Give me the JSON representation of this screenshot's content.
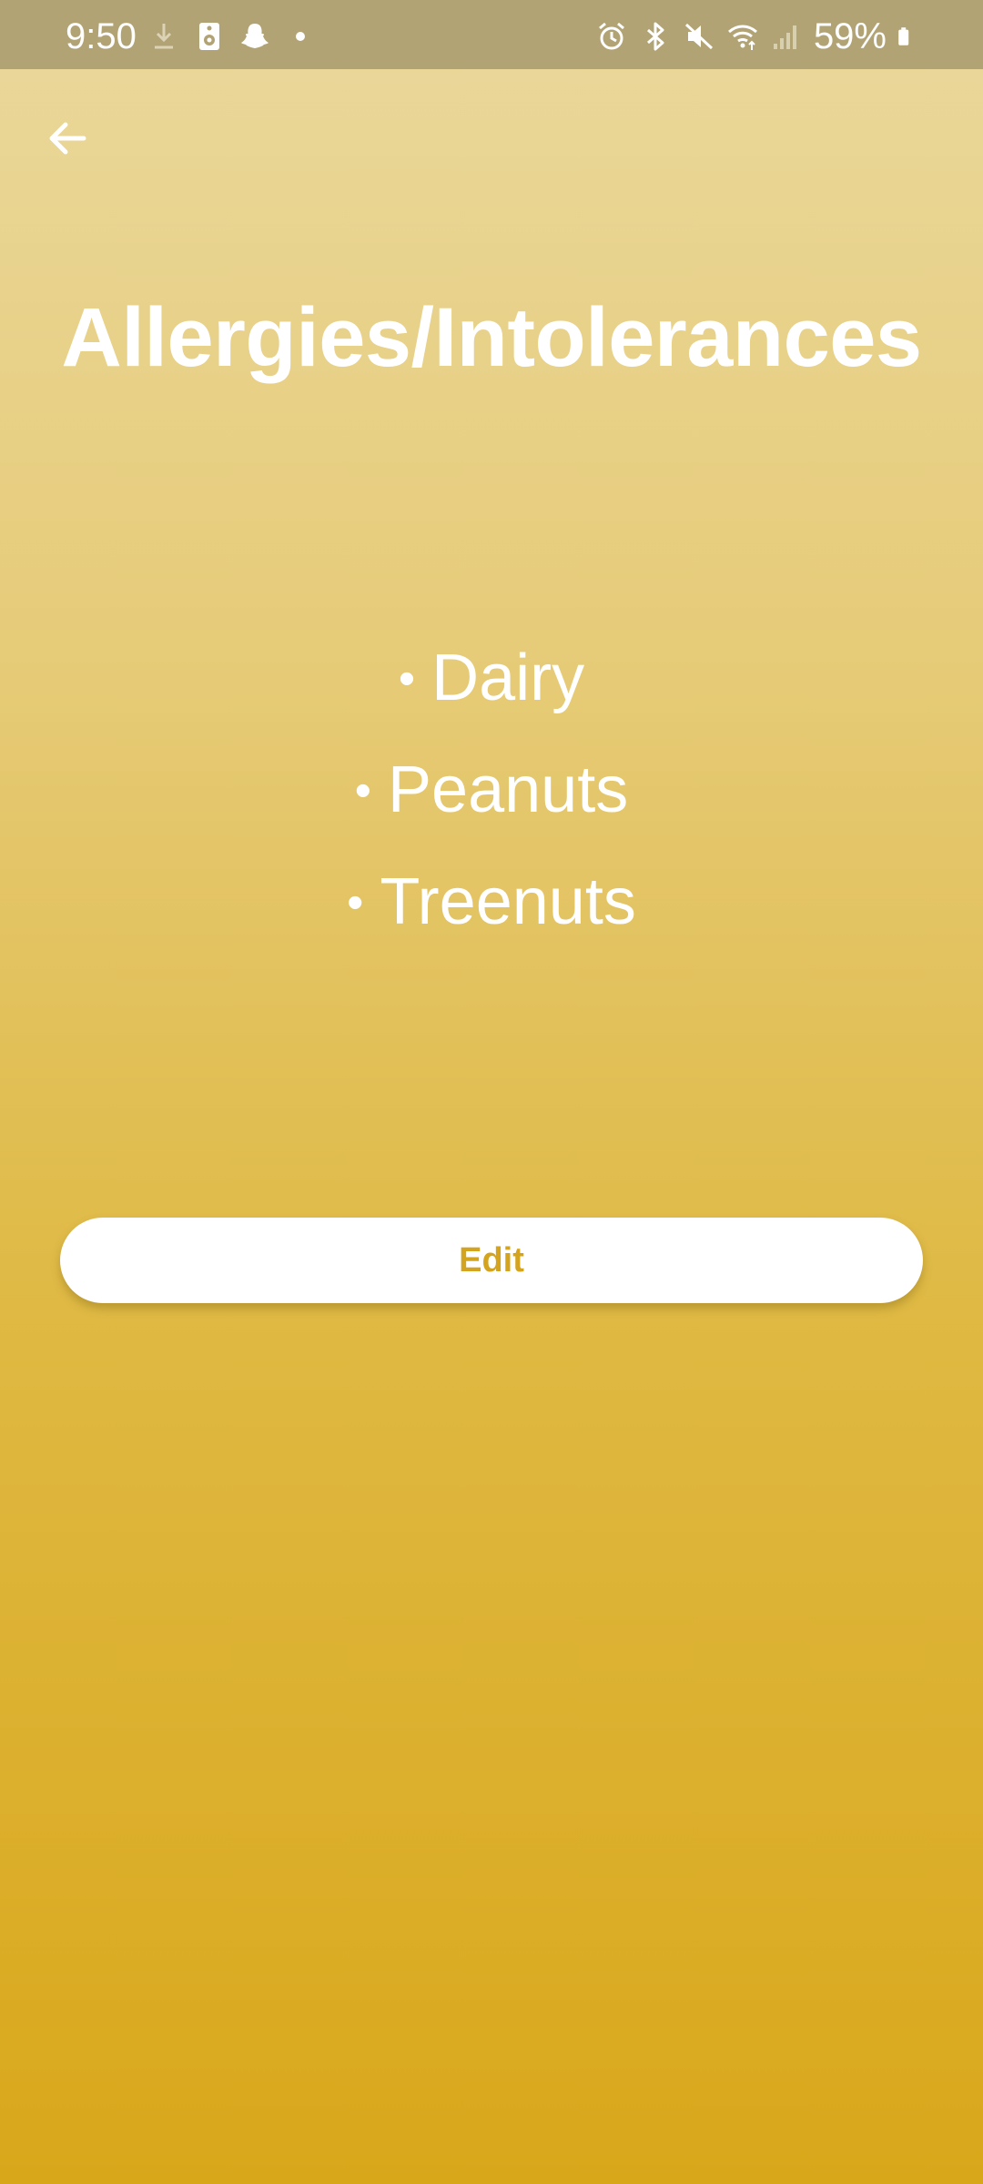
{
  "status_bar": {
    "time": "9:50",
    "battery": "59%",
    "left_icons": [
      "download-icon",
      "speaker-icon",
      "snapchat-icon",
      "dot-icon"
    ],
    "right_icons": [
      "alarm-icon",
      "bluetooth-icon",
      "mute-icon",
      "wifi-icon",
      "signal-icon",
      "battery-icon"
    ]
  },
  "header": {
    "back_icon": "arrow-left-icon"
  },
  "page": {
    "title": "Allergies/Intolerances",
    "bullet": "•",
    "items": [
      "Dairy",
      "Peanuts",
      "Treenuts"
    ]
  },
  "actions": {
    "edit_label": "Edit"
  },
  "colors": {
    "status_bar": "#b2a375",
    "gradient_top": "#ead89c",
    "gradient_bottom": "#d9a71a",
    "accent": "#d4a41e",
    "text": "#ffffff"
  }
}
